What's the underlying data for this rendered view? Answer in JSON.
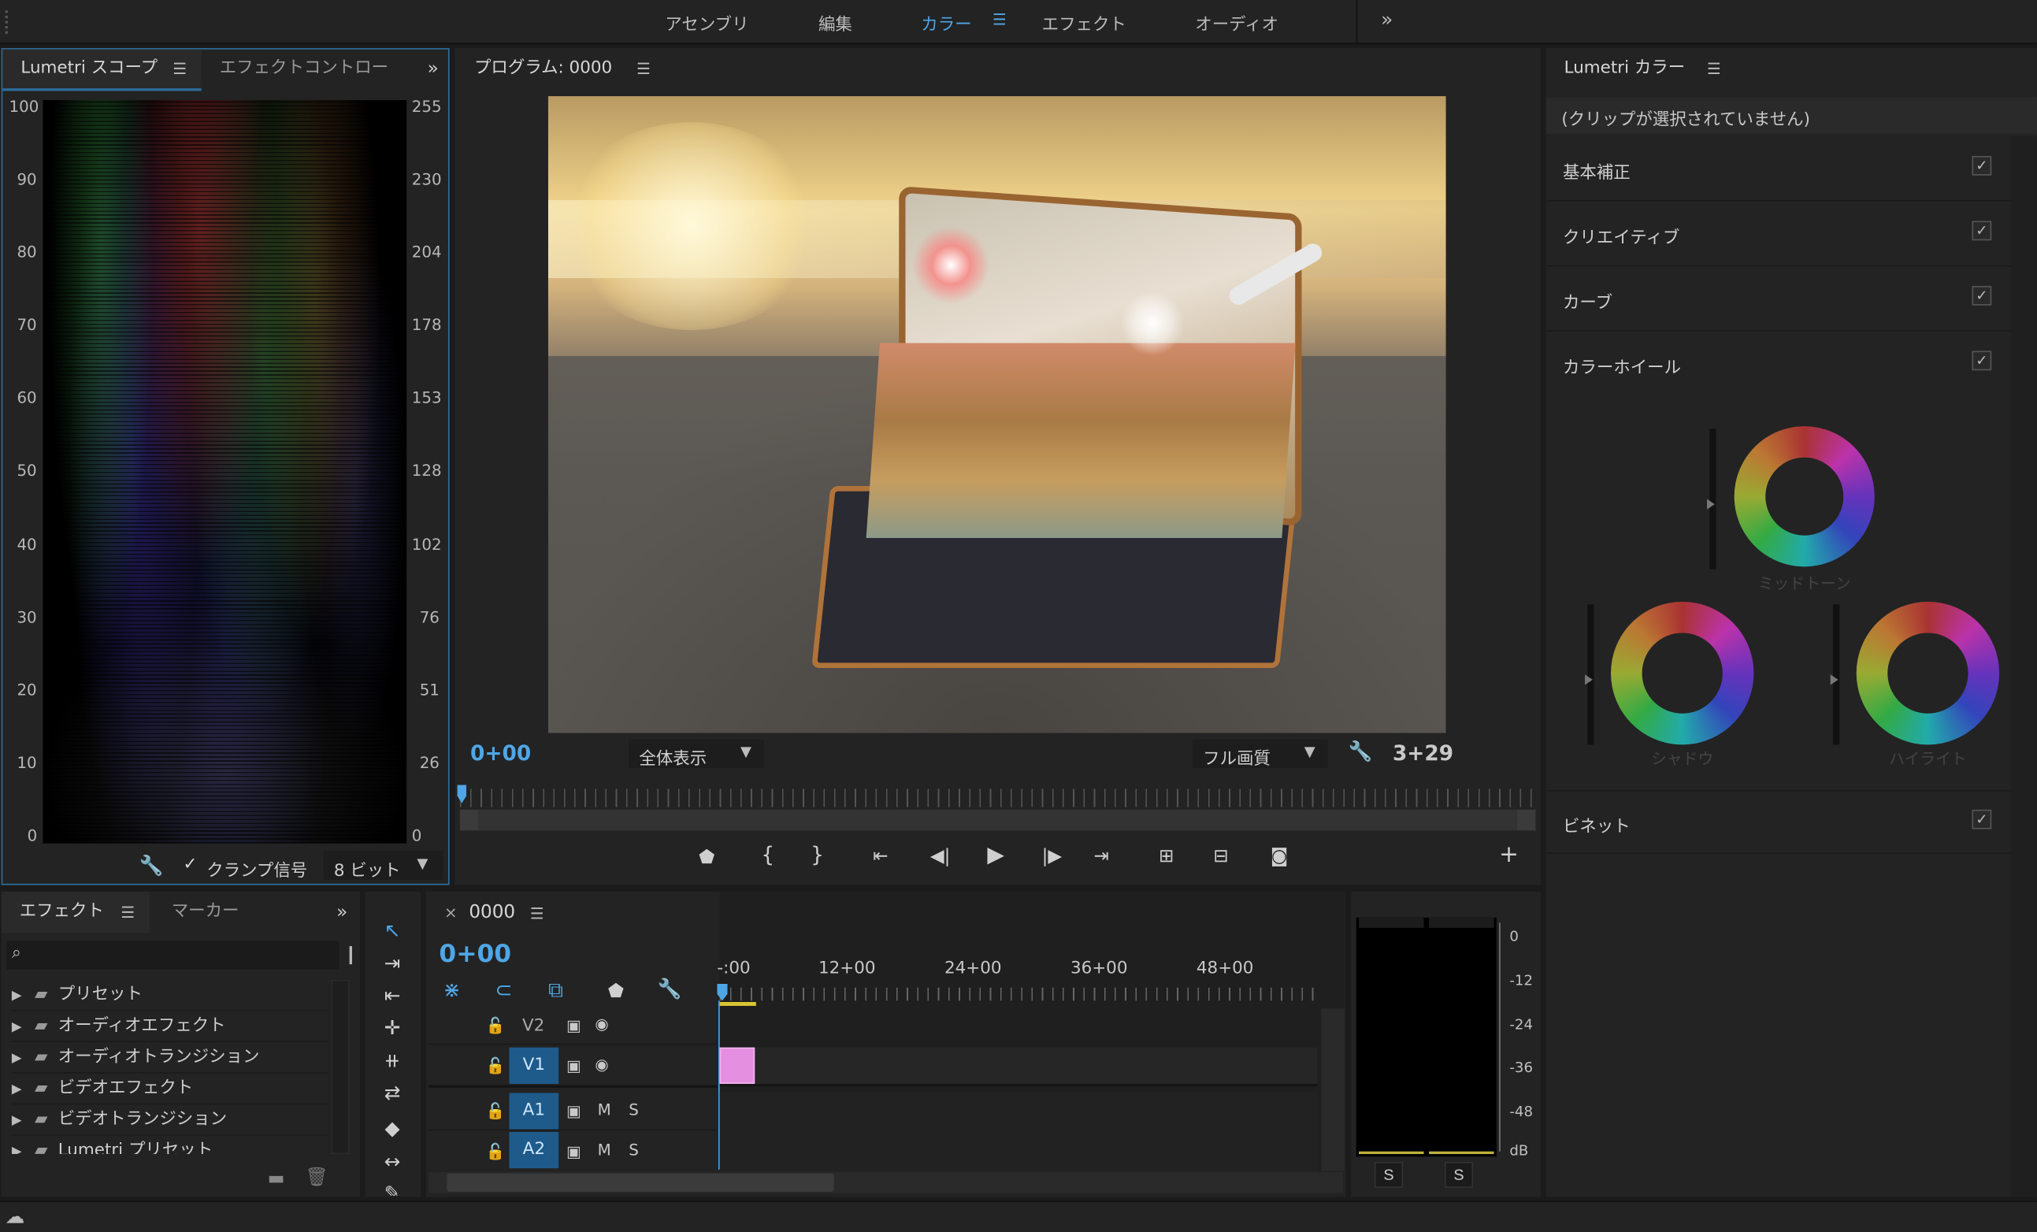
{
  "workspace": {
    "tabs": [
      "アセンブリ",
      "編集",
      "カラー",
      "エフェクト",
      "オーディオ"
    ],
    "active": "カラー",
    "more": "»"
  },
  "scopes": {
    "tab_active": "Lumetri スコープ",
    "tab_other": "エフェクトコントロー",
    "left_axis": [
      "100",
      "90",
      "80",
      "70",
      "60",
      "50",
      "40",
      "30",
      "20",
      "10",
      "0"
    ],
    "right_axis": [
      "255",
      "230",
      "204",
      "178",
      "153",
      "128",
      "102",
      "76",
      "51",
      "26",
      "0"
    ],
    "clamp_label": "クランプ信号",
    "bit_depth": "8 ビット"
  },
  "program": {
    "title": "プログラム: 0000",
    "timecode_left": "0+00",
    "timecode_right": "3+29",
    "zoom": "全体表示",
    "quality": "フル画質"
  },
  "effects": {
    "tab_active": "エフェクト",
    "tab_other": "マーカー",
    "items": [
      "プリセット",
      "オーディオエフェクト",
      "オーディオトランジション",
      "ビデオエフェクト",
      "ビデオトランジション",
      "Lumetri プリセット"
    ]
  },
  "timeline": {
    "name": "0000",
    "timecode": "0+00",
    "ruler": [
      "-:00",
      "12+00",
      "24+00",
      "36+00",
      "48+00"
    ],
    "tracks": [
      "V2",
      "V1",
      "A1",
      "A2"
    ],
    "m": "M",
    "s": "S"
  },
  "meter": {
    "labels": [
      "0",
      "-12",
      "-24",
      "-36",
      "-48",
      "dB"
    ],
    "solo": [
      "S",
      "S"
    ]
  },
  "lumetri": {
    "title": "Lumetri カラー",
    "status": "(クリップが選択されていません)",
    "sections": [
      "基本補正",
      "クリエイティブ",
      "カーブ",
      "カラーホイール",
      "ビネット"
    ],
    "check": "✓",
    "wheels": [
      "ミッドトーン",
      "シャドウ",
      "ハイライト"
    ]
  },
  "colors": {
    "accent": "#4ea6e6",
    "panel": "#232323",
    "clip": "#e48fe0"
  }
}
